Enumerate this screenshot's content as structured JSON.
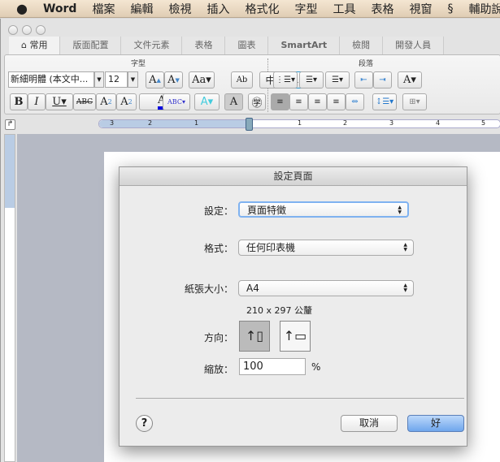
{
  "menubar": {
    "app": "Word",
    "items": [
      "檔案",
      "編輯",
      "檢視",
      "插入",
      "格式化",
      "字型",
      "工具",
      "表格",
      "視窗",
      "輔助說"
    ]
  },
  "ribbon": {
    "tabs": [
      "常用",
      "版面配置",
      "文件元素",
      "表格",
      "圖表",
      "SmartArt",
      "檢閱",
      "開發人員"
    ],
    "font_group": "字型",
    "paragraph_group": "段落",
    "font_name": "新細明體 (本文中...",
    "font_size": "12"
  },
  "ruler": {
    "ticks": [
      "3",
      "2",
      "1",
      "1",
      "2",
      "3",
      "4",
      "5"
    ]
  },
  "dialog": {
    "title": "設定頁面",
    "settings_label": "設定：",
    "settings_value": "頁面特徵",
    "format_label": "格式：",
    "format_value": "任何印表機",
    "paper_label": "紙張大小：",
    "paper_value": "A4",
    "paper_dims": "210 x 297 公釐",
    "orientation_label": "方向：",
    "scale_label": "縮放：",
    "scale_value": "100",
    "percent": "%",
    "help": "?",
    "cancel": "取消",
    "ok": "好",
    "accent": "#7fb2f0"
  }
}
